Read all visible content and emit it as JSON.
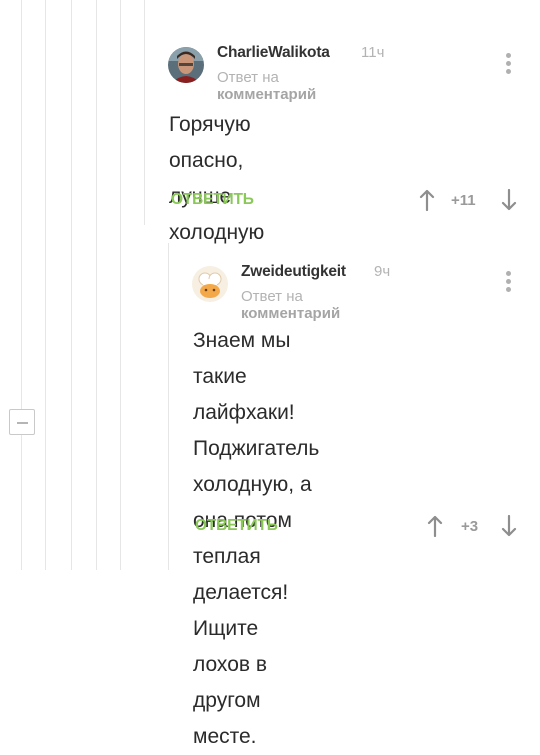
{
  "comments": [
    {
      "author": "CharlieWalikota",
      "time": "11ч",
      "reply_prefix": "Ответ на",
      "reply_link": "комментарий",
      "text_lines": [
        "Горячую опасно, лучше",
        "холодную"
      ],
      "reply_label": "ОТВЕТИТЬ",
      "rating": "+11",
      "avatar_icon": "user-photo-avatar"
    },
    {
      "author": "Zweideutigkeit",
      "time": "9ч",
      "reply_prefix": "Ответ на",
      "reply_link": "комментарий",
      "text_lines": [
        "Знаем мы такие лайфхаки!",
        "Поджигатель холодную, а",
        "она потом теплая делается!",
        "Ищите лохов в другом",
        "месте."
      ],
      "reply_label": "ОТВЕТИТЬ",
      "rating": "+3",
      "avatar_icon": "chef-avatar"
    }
  ],
  "colors": {
    "reply_button": "#8ac858",
    "meta_text": "#b3b3b3",
    "thread_line": "#e6e6e6"
  }
}
